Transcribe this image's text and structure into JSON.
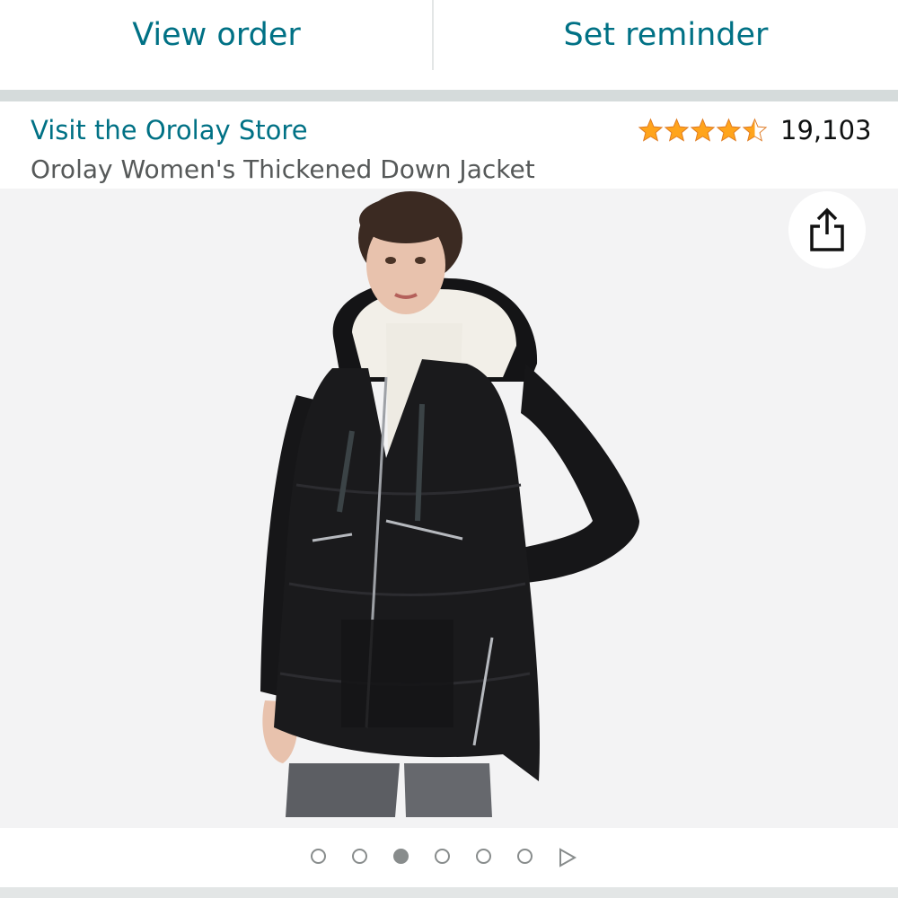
{
  "actions": {
    "view_order": "View order",
    "set_reminder": "Set reminder"
  },
  "product": {
    "store_link": "Visit the Orolay Store",
    "title": "Orolay Women's Thickened Down Jacket",
    "rating": 4.5,
    "rating_count": "19,103",
    "image": "woman wearing black hooded down parka with white sherpa-lined hood"
  },
  "gallery": {
    "total_images": 6,
    "active_index": 2,
    "has_video": true
  },
  "colors": {
    "link": "#007185",
    "star": "#ffa41c",
    "text_secondary": "#565959"
  },
  "icons": {
    "share": "share-icon",
    "play": "play-icon"
  }
}
